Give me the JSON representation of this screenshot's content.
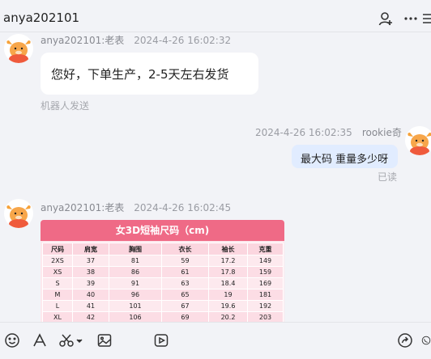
{
  "header": {
    "title": "anya202101",
    "icons": [
      "add-user-icon",
      "more-icon",
      "menu-icon"
    ]
  },
  "messages": [
    {
      "sender": "anya202101:老表",
      "time": "2024-4-26 16:02:32",
      "text": "您好，下单生产，2-5天左右发货",
      "note": "机器人发送"
    },
    {
      "sender": "rookie奇",
      "time": "2024-4-26 16:02:35",
      "text": "最大码 重量多少呀",
      "status": "已读"
    },
    {
      "sender": "anya202101:老表",
      "time": "2024-4-26 16:02:45"
    }
  ],
  "size_chart": {
    "title": "女3D短袖尺码（cm)",
    "headers": [
      "尺码",
      "肩宽",
      "胸围",
      "衣长",
      "袖长",
      "克重"
    ],
    "rows": [
      [
        "2XS",
        "37",
        "81",
        "59",
        "17.2",
        "149"
      ],
      [
        "XS",
        "38",
        "86",
        "61",
        "17.8",
        "159"
      ],
      [
        "S",
        "39",
        "91",
        "63",
        "18.4",
        "169"
      ],
      [
        "M",
        "40",
        "96",
        "65",
        "19",
        "181"
      ],
      [
        "L",
        "41",
        "101",
        "67",
        "19.6",
        "192"
      ],
      [
        "XL",
        "42",
        "106",
        "69",
        "20.2",
        "203"
      ]
    ]
  },
  "toolbar": {
    "icons": [
      "emoji-icon",
      "font-icon",
      "scissors-icon",
      "image-icon",
      "video-icon",
      "share-icon",
      "phone-icon"
    ]
  },
  "colors": {
    "background": "#f2f3f7",
    "bubble_incoming": "#ffffff",
    "bubble_outgoing": "#e1ecff",
    "size_chart_header": "#ef6a86",
    "size_chart_body": "#fde9ee"
  }
}
